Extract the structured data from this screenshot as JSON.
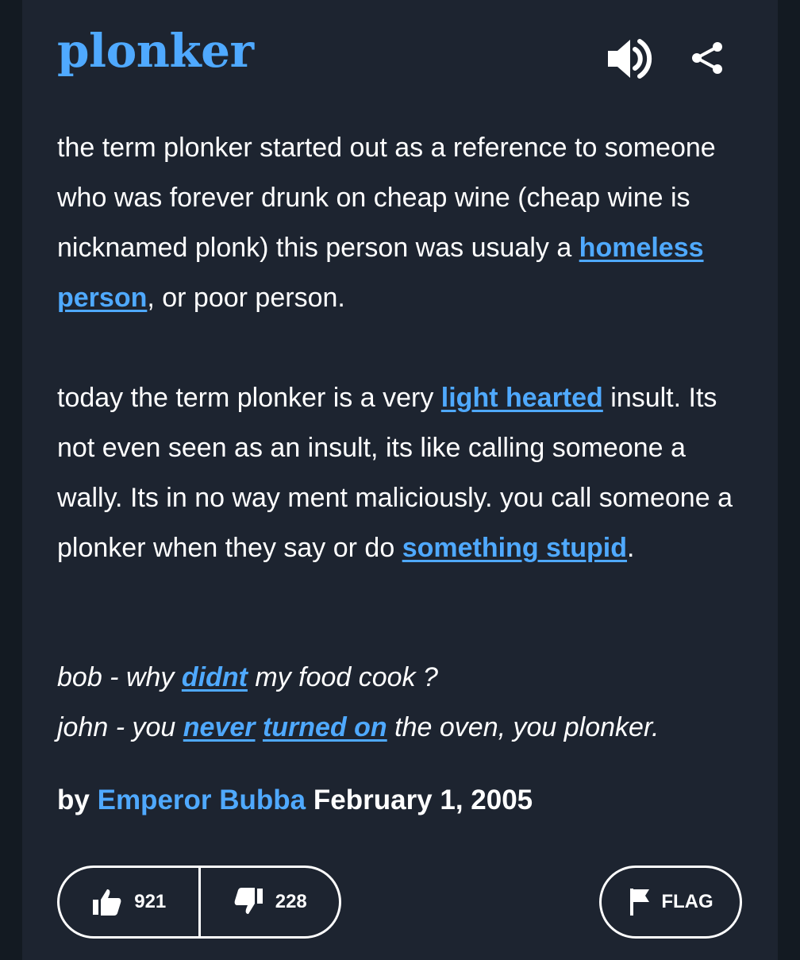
{
  "entry": {
    "word": "plonker",
    "meaning_p1": [
      {
        "t": "the term plonker started out as a reference to someone who was forever drunk on cheap wine (cheap wine is nicknamed plonk) this person was usualy a "
      },
      {
        "t": "homeless person",
        "link": true
      },
      {
        "t": ", or poor person."
      }
    ],
    "meaning_p2": [
      {
        "t": "today the term plonker is a very "
      },
      {
        "t": "light hearted",
        "link": true
      },
      {
        "t": " insult. Its not even seen as an insult, its like calling someone a wally. Its in no way ment maliciously. you call someone a plonker when they say or do "
      },
      {
        "t": "something stupid",
        "link": true
      },
      {
        "t": "."
      }
    ],
    "example_line1": [
      {
        "t": "bob - why "
      },
      {
        "t": "didnt",
        "link": true
      },
      {
        "t": " my food cook ?"
      }
    ],
    "example_line2": [
      {
        "t": "john - you "
      },
      {
        "t": "never",
        "link": true
      },
      {
        "t": " "
      },
      {
        "t": "turned on",
        "link": true
      },
      {
        "t": " the oven, you plonker."
      }
    ],
    "by_label": "by",
    "author": "Emperor Bubba",
    "date": "February 1, 2005"
  },
  "actions": {
    "upvotes": "921",
    "downvotes": "228",
    "flag_label": "FLAG"
  },
  "icons": {
    "sound": "speaker-icon",
    "share": "share-icon",
    "upvote": "thumbs-up-icon",
    "downvote": "thumbs-down-icon",
    "flag": "flag-icon"
  },
  "colors": {
    "background": "#1d2430",
    "accent": "#4fa9ff",
    "text": "#ffffff"
  }
}
